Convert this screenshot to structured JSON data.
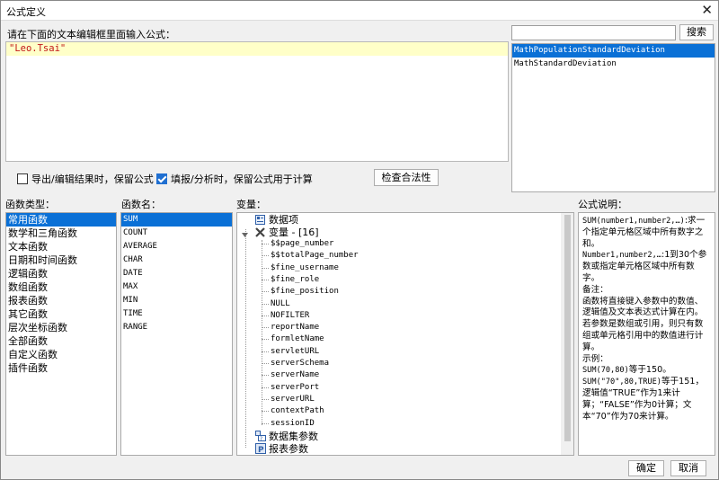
{
  "window": {
    "title": "公式定义",
    "close_glyph": "✕"
  },
  "editor": {
    "prompt_label": "请在下面的文本编辑框里面输入公式：",
    "value": "\"Leo.Tsai\""
  },
  "options": {
    "export_label": "导出/编辑结果时，保留公式",
    "export_checked": false,
    "fill_label": "填报/分析时，保留公式用于计算",
    "fill_checked": true,
    "check_button": "检查合法性"
  },
  "search": {
    "value": "",
    "button": "搜索",
    "results": [
      "MathPopulationStandardDeviation",
      "MathStandardDeviation"
    ],
    "selected_index": 0
  },
  "function_types": {
    "label": "函数类型：",
    "items": [
      "常用函数",
      "数学和三角函数",
      "文本函数",
      "日期和时间函数",
      "逻辑函数",
      "数组函数",
      "报表函数",
      "其它函数",
      "层次坐标函数",
      "全部函数",
      "自定义函数",
      "插件函数"
    ],
    "selected_index": 0
  },
  "function_names": {
    "label": "函数名：",
    "items": [
      "SUM",
      "COUNT",
      "AVERAGE",
      "CHAR",
      "DATE",
      "MAX",
      "MIN",
      "TIME",
      "RANGE"
    ],
    "selected_index": 0
  },
  "variables": {
    "label": "变量：",
    "data_items": "数据项",
    "var_group": "变量 - [16]",
    "vars": [
      "$$page_number",
      "$$totalPage_number",
      "$fine_username",
      "$fine_role",
      "$fine_position",
      "NULL",
      "NOFILTER",
      "reportName",
      "formletName",
      "servletURL",
      "serverSchema",
      "serverName",
      "serverPort",
      "serverURL",
      "contextPath",
      "sessionID"
    ],
    "dataset_params": "数据集参数",
    "report_params": "报表参数",
    "icons": [
      "data-item-icon",
      "variable-icon",
      "dataset-param-icon",
      "report-param-icon"
    ]
  },
  "description": {
    "label": "公式说明：",
    "lines": [
      {
        "mono": "SUM(number1,number2,…)",
        "text": ":求一个指定单元格区域中所有数字之和。"
      },
      {
        "mono": "Number1,number2,…",
        "text": ":1到30个参数或指定单元格区域中所有数字。"
      },
      {
        "mono": "",
        "text": "备注："
      },
      {
        "mono": "",
        "text": "函数将直接键入参数中的数值、逻辑值及文本表达式计算在内。若参数是数组或引用，则只有数组或单元格引用中的数值进行计算。"
      },
      {
        "mono": "",
        "text": "示例："
      },
      {
        "mono": "SUM(70,80)",
        "text": "等于150。"
      },
      {
        "mono": "SUM(\"70\",80,TRUE)",
        "text": "等于151，逻辑值“TRUE”作为1来计算；“FALSE”作为0计算；文本“70”作为70来计算。"
      }
    ]
  },
  "footer": {
    "ok": "确定",
    "cancel": "取消"
  },
  "colors": {
    "selection": "#0a70d6",
    "editor_highlight": "#ffffc8",
    "string_literal": "#c21818"
  }
}
